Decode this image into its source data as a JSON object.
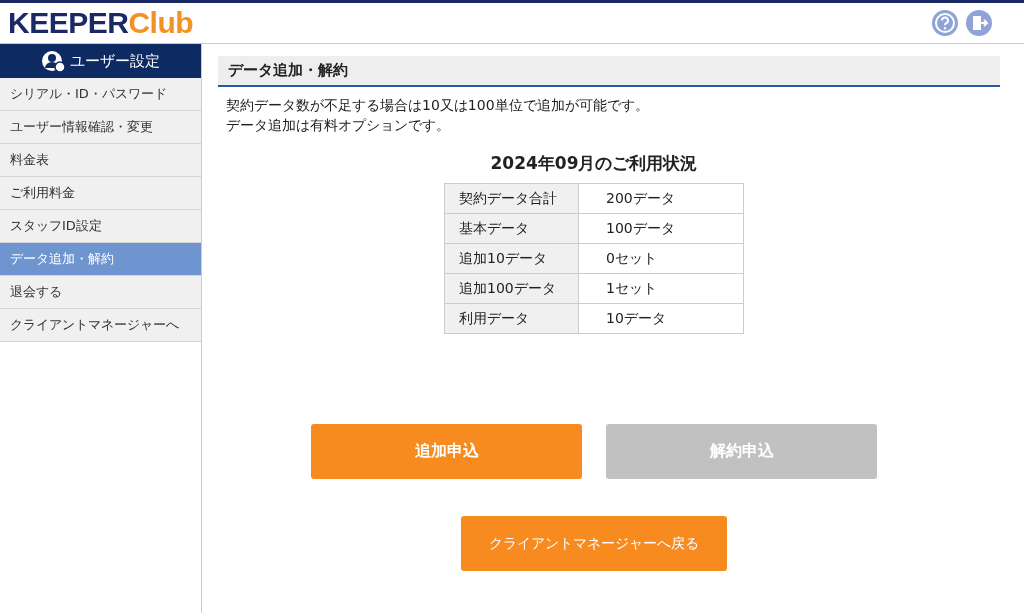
{
  "logo": {
    "part_1": "KEEPER",
    "part_2": "Club"
  },
  "sidebar": {
    "title": "ユーザー設定",
    "items": [
      {
        "label": "シリアル・ID・パスワード",
        "selected": false
      },
      {
        "label": "ユーザー情報確認・変更",
        "selected": false
      },
      {
        "label": "料金表",
        "selected": false
      },
      {
        "label": "ご利用料金",
        "selected": false
      },
      {
        "label": "スタッフID設定",
        "selected": false
      },
      {
        "label": "データ追加・解約",
        "selected": true
      },
      {
        "label": "退会する",
        "selected": false
      },
      {
        "label": "クライアントマネージャーへ",
        "selected": false
      }
    ]
  },
  "page_title": "データ追加・解約",
  "description": [
    "契約データ数が不足する場合は10又は100単位で追加が可能です。",
    "データ追加は有料オプションです。"
  ],
  "usage": {
    "title": "2024年09月のご利用状況",
    "rows": [
      {
        "label": "契約データ合計",
        "value": "200データ"
      },
      {
        "label": "基本データ",
        "value": "100データ"
      },
      {
        "label": "追加10データ",
        "value": "0セット"
      },
      {
        "label": "追加100データ",
        "value": "1セット"
      },
      {
        "label": "利用データ",
        "value": "10データ"
      }
    ]
  },
  "buttons": [
    {
      "label": "追加申込",
      "disabled": false
    },
    {
      "label": "解約申込",
      "disabled": true
    }
  ],
  "back_button": "クライアントマネージャーへ戻る"
}
